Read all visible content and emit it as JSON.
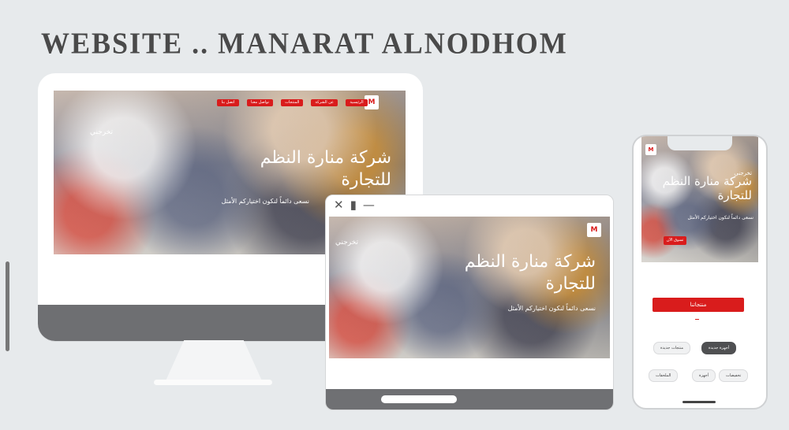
{
  "title": "WEBSITE .. MANARAT ALNODHOM",
  "colors": {
    "background": "#e7eaec",
    "accent": "#d91c1c",
    "device_dark": "#6e6f72"
  },
  "company": {
    "name_line1": "شركة منارة النظم",
    "name_line2": "للتجارة",
    "tagline": "نسعى دائماً لنكون اختياركم الأمثل"
  },
  "logo": {
    "text": "M"
  },
  "desktop": {
    "nav_items": [
      "الرئيسية",
      "عن الشركة",
      "المنتجات",
      "تواصل معنا",
      "اتصل بنا"
    ],
    "side_label": "تخرجني"
  },
  "laptop": {
    "side_label": "تخرجني",
    "icons": [
      "close-icon",
      "file-icon",
      "minimize-icon"
    ]
  },
  "mobile": {
    "side_label": "تخرجني",
    "small_button": "تسوق الآن",
    "cta": "منتجاتنا",
    "chips": [
      "منتجات جديدة",
      "أجهزة جديدة",
      "الملحقات",
      "أجهزة",
      "تخفيضات"
    ]
  }
}
